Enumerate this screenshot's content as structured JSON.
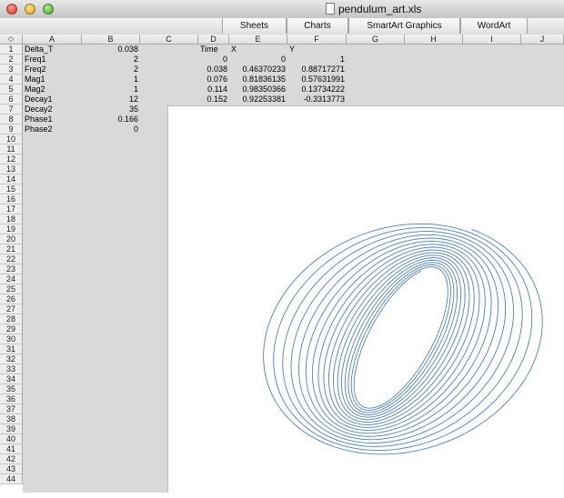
{
  "window": {
    "title": "pendulum_art.xls"
  },
  "ribbon": {
    "tabs": [
      "Sheets",
      "Charts",
      "SmartArt Graphics",
      "WordArt"
    ]
  },
  "columns": [
    "A",
    "B",
    "C",
    "D",
    "E",
    "F",
    "G",
    "H",
    "I",
    "J"
  ],
  "rows": [
    "1",
    "2",
    "3",
    "4",
    "5",
    "6",
    "7",
    "8",
    "9",
    "10",
    "11",
    "12",
    "13",
    "14",
    "15",
    "16",
    "17",
    "18",
    "19",
    "20",
    "21",
    "22",
    "23",
    "24",
    "25",
    "26",
    "27",
    "28",
    "29",
    "30",
    "31",
    "32",
    "33",
    "34",
    "35",
    "36",
    "37",
    "38",
    "39",
    "40",
    "41",
    "42",
    "43",
    "44"
  ],
  "params": [
    {
      "label": "Delta_T",
      "value": "0.038"
    },
    {
      "label": "Freq1",
      "value": "2"
    },
    {
      "label": "Freq2",
      "value": "2"
    },
    {
      "label": "Mag1",
      "value": "1"
    },
    {
      "label": "Mag2",
      "value": "1"
    },
    {
      "label": "Decay1",
      "value": "12"
    },
    {
      "label": "Decay2",
      "value": "35"
    },
    {
      "label": "Phase1",
      "value": "0.166"
    },
    {
      "label": "Phase2",
      "value": "0"
    }
  ],
  "table": {
    "headers": [
      "Time",
      "X",
      "Y"
    ],
    "rows": [
      [
        "0",
        "0",
        "1"
      ],
      [
        "0.038",
        "0.46370233",
        "0.88717271"
      ],
      [
        "0.076",
        "0.81836135",
        "0.57631991"
      ],
      [
        "0.114",
        "0.98350366",
        "0.13734222"
      ],
      [
        "0.152",
        "0.92253381",
        "-0.3313773"
      ]
    ]
  },
  "chart_data": {
    "type": "line",
    "series_color": "#4f81bd",
    "grid": false,
    "legend": "none",
    "parameters": {
      "delta_t": 0.038,
      "freq1": 2,
      "freq2": 2,
      "mag1": 1,
      "mag2": 1,
      "decay1": 12,
      "decay2": 35,
      "phase1": 0.166,
      "phase2": 0
    },
    "x": [
      0,
      0.46370233,
      0.81836135,
      0.98350366,
      0.92253381
    ],
    "y": [
      1,
      0.88717271,
      0.57631991,
      0.13734222,
      -0.3313773
    ],
    "xlim": [
      -1,
      1
    ],
    "ylim": [
      -1,
      1
    ]
  }
}
